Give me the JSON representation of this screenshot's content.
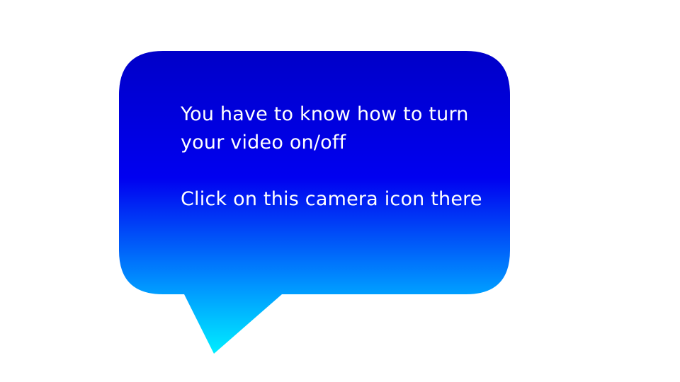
{
  "bubble": {
    "line_1": "You have to know how to turn your video on/off",
    "line_2": "Click on this camera icon there"
  },
  "colors": {
    "gradient_top": "#0000C8",
    "gradient_mid": "#0000F0",
    "gradient_lower": "#0096FF",
    "gradient_bottom": "#00EEFF",
    "text": "#FFFFFF",
    "background": "#FFFFFF"
  }
}
